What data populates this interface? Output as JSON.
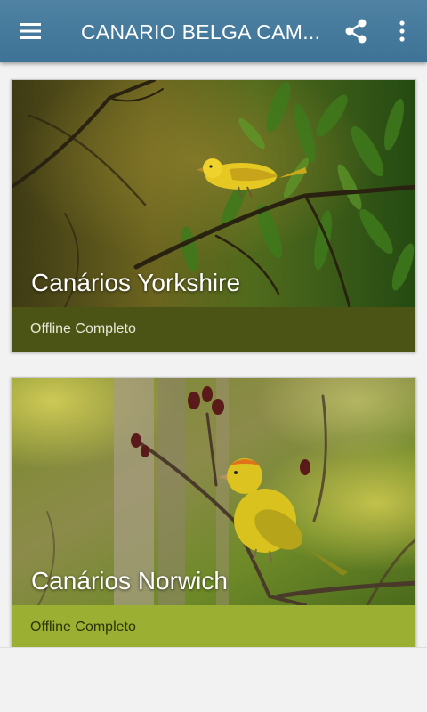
{
  "app_bar": {
    "title": "CANARIO BELGA CAM...",
    "menu_icon": "hamburger-menu-icon",
    "share_icon": "share-icon",
    "more_icon": "more-vert-icon"
  },
  "cards": [
    {
      "title": "Canários Yorkshire",
      "subtitle": "Offline Completo",
      "strip_color": "#4b5414"
    },
    {
      "title": "Canários Norwich",
      "subtitle": "Offline Completo",
      "strip_color": "#9bb032"
    }
  ],
  "colors": {
    "app_bar": "#3e7396",
    "background": "#f2f2f2"
  }
}
